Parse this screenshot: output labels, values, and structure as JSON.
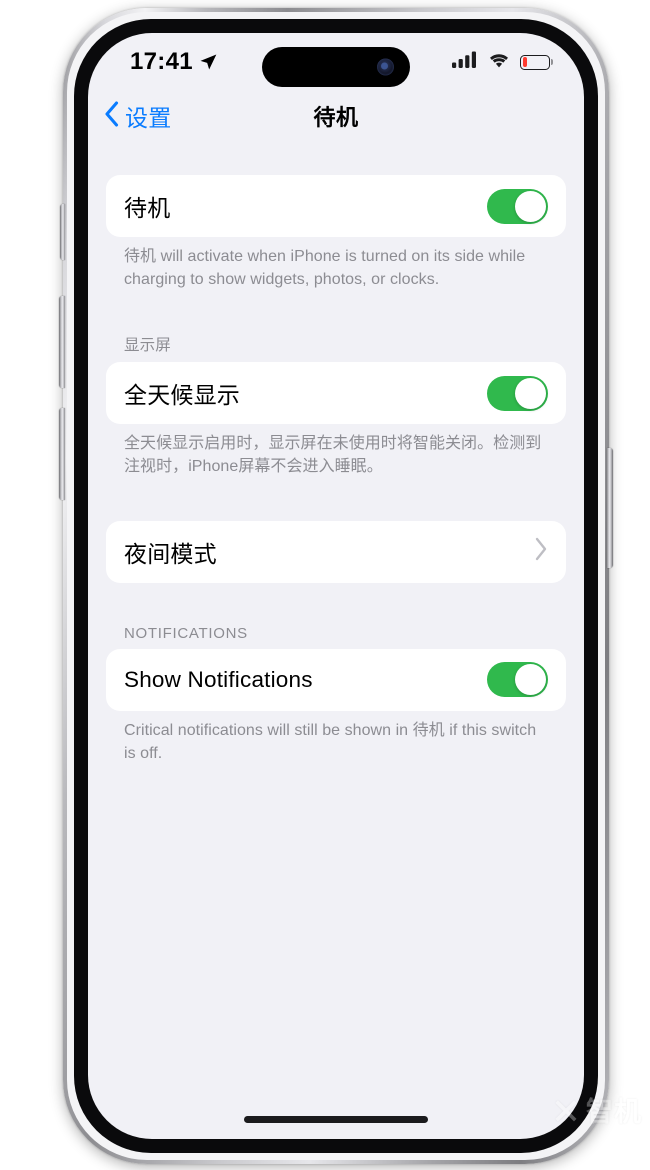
{
  "status_bar": {
    "time": "17:41",
    "location_icon": "location-arrow-icon",
    "cellular_icon": "cellular-signal-icon",
    "cellular_bars": 4,
    "wifi_icon": "wifi-icon",
    "battery_icon": "battery-low-icon",
    "battery_percent": 15,
    "battery_color": "#ff3b30"
  },
  "nav": {
    "back_label": "设置",
    "back_icon": "chevron-left-icon",
    "title": "待机",
    "tint_color": "#0a7cff"
  },
  "sections": [
    {
      "header": "",
      "rows": [
        {
          "label": "待机",
          "control": "toggle",
          "value": "on"
        }
      ],
      "footer": "待机 will activate when iPhone is turned on its side while charging to show widgets, photos, or clocks."
    },
    {
      "header": "显示屏",
      "rows": [
        {
          "label": "全天候显示",
          "control": "toggle",
          "value": "on"
        }
      ],
      "footer": "全天候显示启用时，显示屏在未使用时将智能关闭。检测到注视时，iPhone屏幕不会进入睡眠。"
    },
    {
      "header": "",
      "rows": [
        {
          "label": "夜间模式",
          "control": "disclosure",
          "value": ""
        }
      ],
      "footer": ""
    },
    {
      "header": "NOTIFICATIONS",
      "rows": [
        {
          "label": "Show Notifications",
          "control": "toggle",
          "value": "on"
        }
      ],
      "footer": "Critical notifications will still be shown in 待机 if this switch is off."
    }
  ],
  "theme": {
    "background": "#f1f1f6",
    "card": "#ffffff",
    "toggle_on": "#30b94d",
    "secondary_text": "#8c8c92"
  },
  "watermark": {
    "mark": "✕",
    "text": "智机"
  },
  "home_indicator": "home-indicator"
}
